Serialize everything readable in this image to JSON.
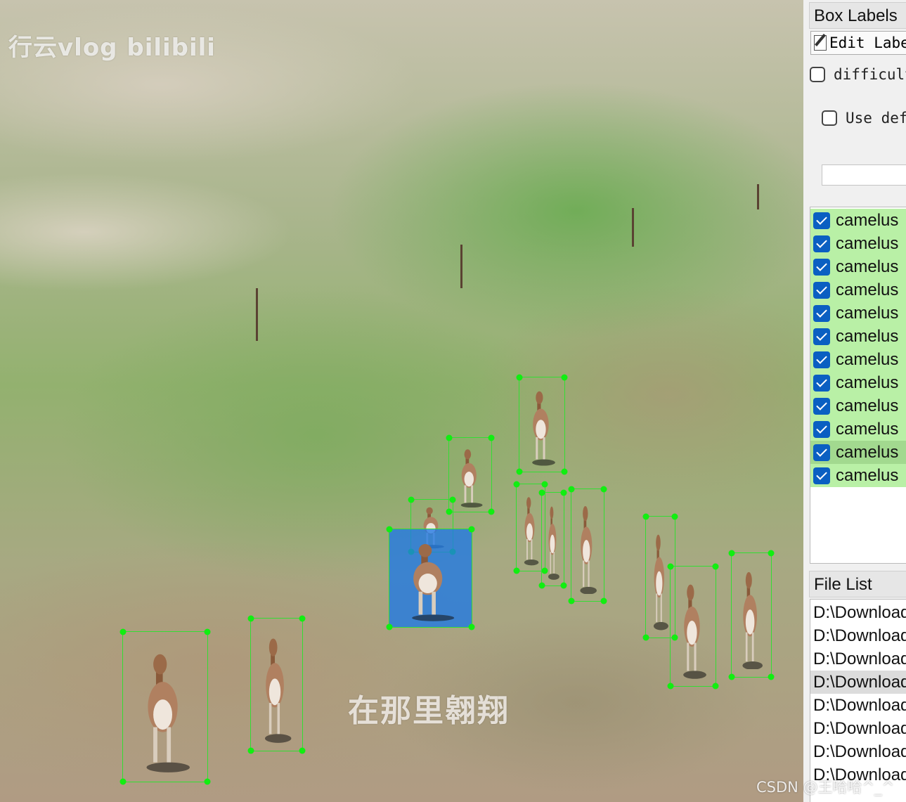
{
  "canvas": {
    "watermark_top": "行云vlog bilibili",
    "subtitle": "在那里翱翔",
    "watermark_csdn": "CSDN @王哈哈^_^"
  },
  "annotations": {
    "selected_box_index": 5,
    "box_count": 12
  },
  "sidebar": {
    "box_labels_title": "Box Labels",
    "edit_label_button": "Edit Label",
    "difficult_label": "difficult",
    "use_default_label": "Use default label",
    "default_label_value": "",
    "labels": [
      {
        "text": "camelus",
        "checked": true
      },
      {
        "text": "camelus",
        "checked": true
      },
      {
        "text": "camelus",
        "checked": true
      },
      {
        "text": "camelus",
        "checked": true
      },
      {
        "text": "camelus",
        "checked": true
      },
      {
        "text": "camelus",
        "checked": true
      },
      {
        "text": "camelus",
        "checked": true
      },
      {
        "text": "camelus",
        "checked": true
      },
      {
        "text": "camelus",
        "checked": true
      },
      {
        "text": "camelus",
        "checked": true
      },
      {
        "text": "camelus",
        "checked": true
      },
      {
        "text": "camelus",
        "checked": true
      }
    ],
    "active_label_index": 10,
    "file_list_title": "File List",
    "files": [
      "D:\\Download",
      "D:\\Download",
      "D:\\Download",
      "D:\\Download",
      "D:\\Download",
      "D:\\Download",
      "D:\\Download",
      "D:\\Download"
    ],
    "selected_file_index": 3
  },
  "colors": {
    "box_outline": "#33dd33",
    "handle": "#11ee11",
    "selected_fill": "#1e78e6",
    "label_bg": "#b9f0a6",
    "checkbox_blue": "#0a5fc2"
  }
}
